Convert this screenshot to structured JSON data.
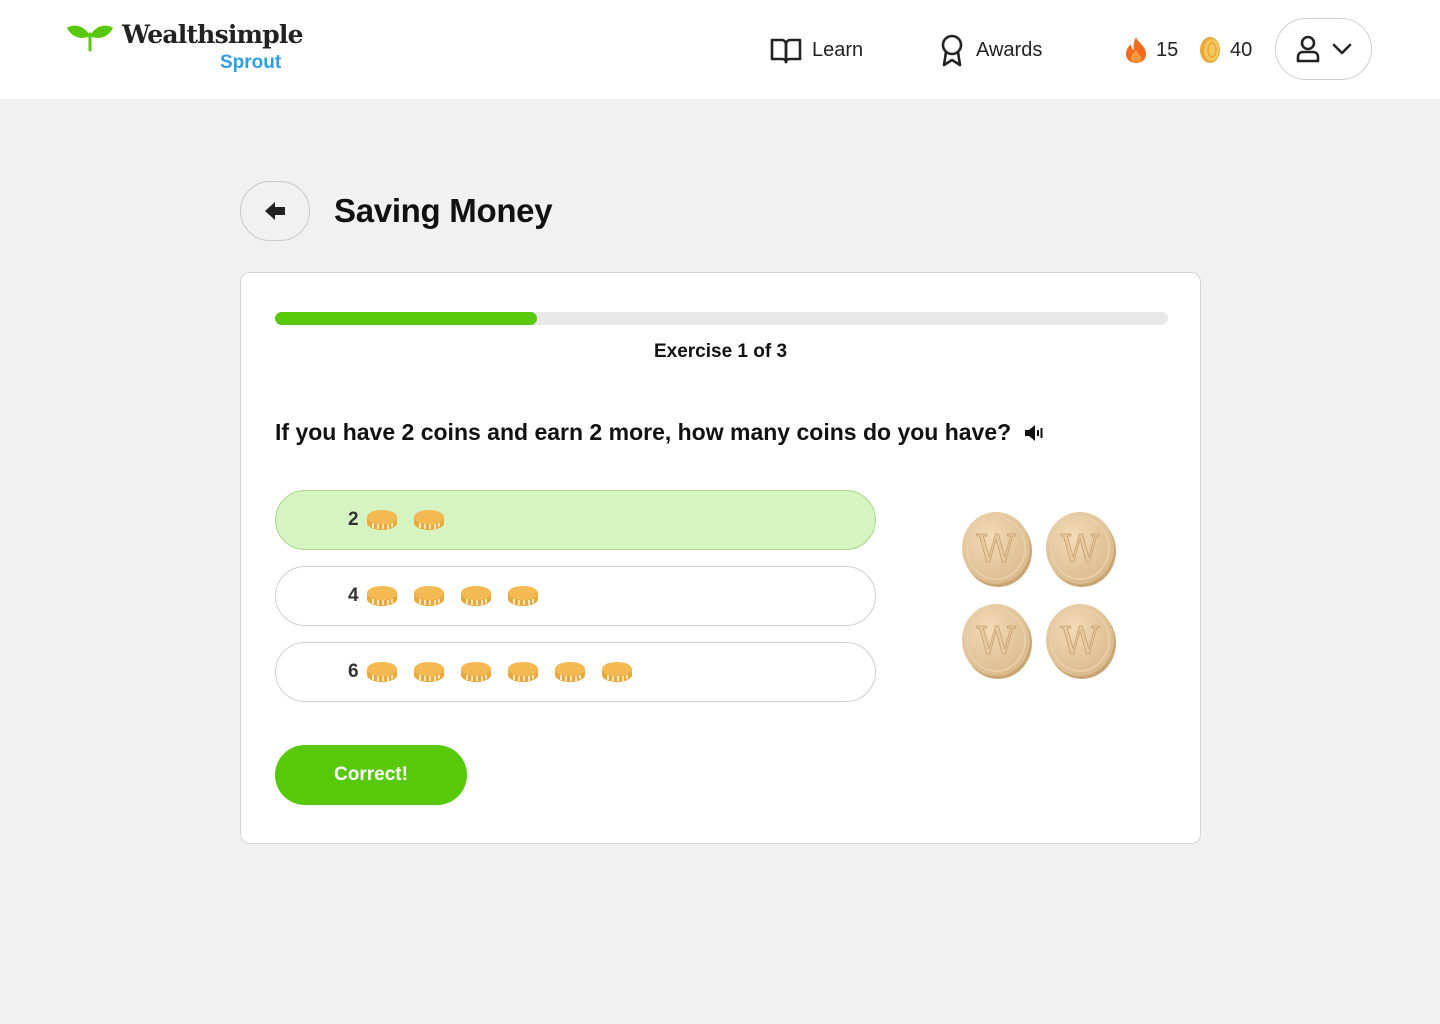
{
  "brand": {
    "name": "Wealthsimple",
    "product": "Sprout",
    "accent": "#57c90a",
    "product_color": "#2d9ee8"
  },
  "nav": {
    "learn": {
      "label": "Learn",
      "icon": "book-icon"
    },
    "awards": {
      "label": "Awards",
      "icon": "ribbon-icon"
    }
  },
  "stats": {
    "streak": {
      "value": "15",
      "icon": "flame-icon"
    },
    "coins": {
      "value": "40",
      "icon": "coin-icon"
    }
  },
  "account": {
    "icon": "user-icon",
    "menu_icon": "chevron-down-icon"
  },
  "page": {
    "title": "Saving Money",
    "back_icon": "arrow-left-icon"
  },
  "exercise": {
    "progress_fraction": 0.293,
    "label": "Exercise 1 of 3",
    "question": "If you have 2 coins and earn 2 more, how many coins do you have?",
    "question_audio_icon": "speaker-icon",
    "options": [
      {
        "label": "2",
        "coins": 2,
        "selected": true
      },
      {
        "label": "4",
        "coins": 4,
        "selected": false
      },
      {
        "label": "6",
        "coins": 6,
        "selected": false
      }
    ],
    "visual_coins": 4,
    "visual_coin_letter": "W",
    "button_label": "Correct!"
  }
}
